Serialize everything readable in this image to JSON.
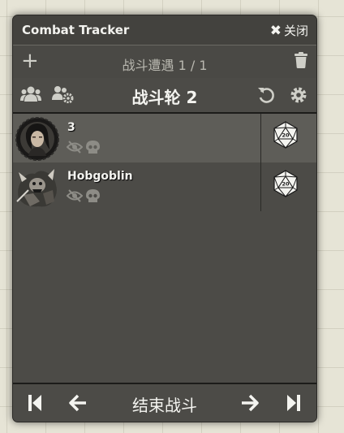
{
  "window": {
    "title": "Combat Tracker",
    "close_label": "关闭"
  },
  "encounter": {
    "title": "战斗遭遇 1 / 1"
  },
  "round": {
    "title": "战斗轮 2"
  },
  "combatants": [
    {
      "name": "3",
      "active": true
    },
    {
      "name": "Hobgoblin",
      "active": false
    }
  ],
  "footer": {
    "end_combat_label": "结束战斗"
  },
  "die_face_value": "20",
  "icons": {
    "add": "plus-icon",
    "delete": "trash-icon",
    "players": "users-icon",
    "npcs": "users-gear-icon",
    "reset": "undo-icon",
    "settings": "gear-icon",
    "hidden": "eye-slash-icon",
    "defeated": "skull-icon",
    "roll": "d20-icon"
  },
  "colors": {
    "panel": "#4c4b47",
    "active_row": "#5e5d58",
    "text": "#f4f4f0",
    "muted": "#b9b8b0"
  }
}
